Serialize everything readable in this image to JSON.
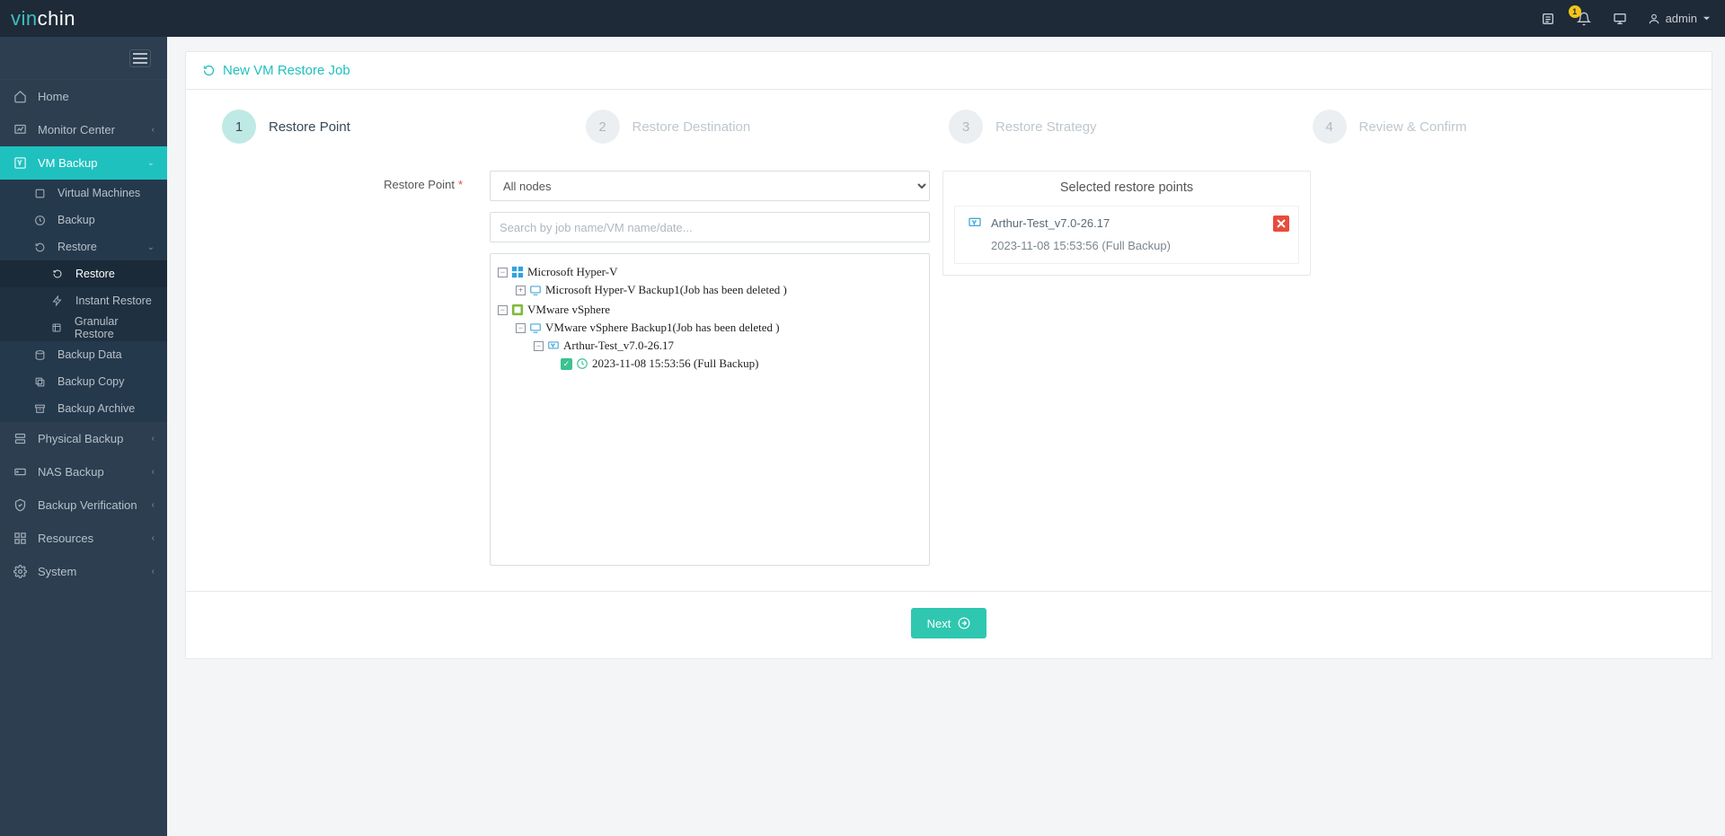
{
  "brand": {
    "part1": "vin",
    "part2": "chin"
  },
  "topbar": {
    "notification_count": "1",
    "user": "admin"
  },
  "sidebar": {
    "home": "Home",
    "monitor": "Monitor Center",
    "vmbackup": "VM Backup",
    "sub": {
      "vms": "Virtual Machines",
      "backup": "Backup",
      "restore": "Restore",
      "restore_sub": {
        "restore": "Restore",
        "instant": "Instant Restore",
        "granular": "Granular Restore"
      },
      "backup_data": "Backup Data",
      "backup_copy": "Backup Copy",
      "backup_archive": "Backup Archive"
    },
    "physical": "Physical Backup",
    "nas": "NAS Backup",
    "verification": "Backup Verification",
    "resources": "Resources",
    "system": "System"
  },
  "page": {
    "title": "New VM Restore Job",
    "steps": [
      "Restore Point",
      "Restore Destination",
      "Restore Strategy",
      "Review & Confirm"
    ],
    "field_label": "Restore Point",
    "node_select": "All nodes",
    "search_placeholder": "Search by job name/VM name/date...",
    "tree": {
      "hyperv": "Microsoft Hyper-V",
      "hyperv_job": "Microsoft Hyper-V Backup1(Job has been deleted )",
      "vsphere": "VMware vSphere",
      "vsphere_job": "VMware vSphere Backup1(Job has been deleted )",
      "vm": "Arthur-Test_v7.0-26.17",
      "point": "2023-11-08 15:53:56 (Full  Backup)"
    },
    "selected_header": "Selected restore points",
    "selected": {
      "name": "Arthur-Test_v7.0-26.17",
      "date": "2023-11-08 15:53:56 (Full Backup)"
    },
    "next": "Next"
  }
}
